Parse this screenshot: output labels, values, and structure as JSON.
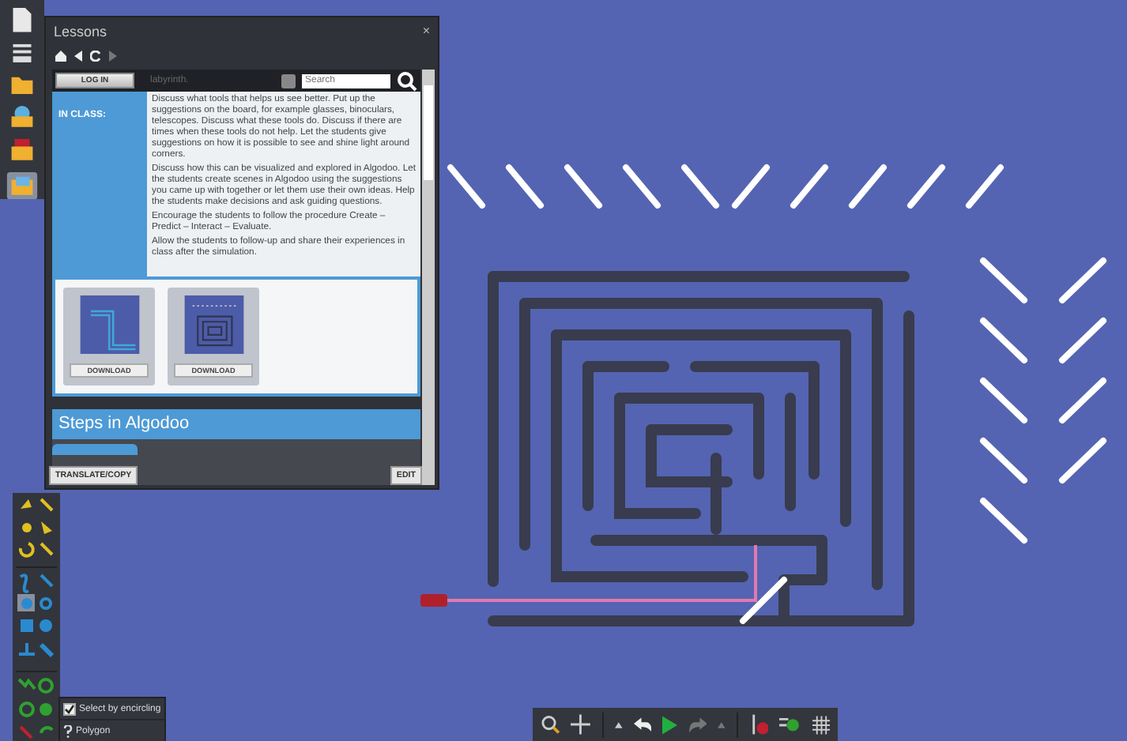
{
  "window": {
    "title": "Lessons",
    "close": "×"
  },
  "lesson": {
    "login_button": "LOG IN",
    "search": {
      "placeholder": "Search"
    },
    "fragment": "labyrinth.",
    "section_label": "IN CLASS:",
    "paragraphs": [
      "Discuss what tools that helps us see better. Put up the suggestions on the board, for example glasses, binoculars, telescopes. Discuss what these tools do. Discuss if there are times when these tools do not help. Let the students give suggestions on how it is possible to see and shine light around corners.",
      "Discuss how this can be visualized and explored in Algodoo. Let the students create scenes in Algodoo using the suggestions you came up with together or let them use their own ideas. Help the students make decisions and ask guiding questions.",
      "Encourage the students to follow the procedure Create – Predict – Interact – Evaluate.",
      "Allow the students to follow-up and share their experiences in class after the simulation."
    ],
    "downloads": [
      {
        "kind": "corridor",
        "button": "DOWNLOAD"
      },
      {
        "kind": "maze",
        "button": "DOWNLOAD"
      }
    ],
    "steps_title": "Steps in Algodoo",
    "translate_button": "TRANSLATE/COPY",
    "edit_button": "EDIT"
  },
  "popup": [
    {
      "kind": "checkbox",
      "label": "Select by encircling",
      "checked": true
    },
    {
      "kind": "help",
      "label": "Polygon"
    }
  ]
}
